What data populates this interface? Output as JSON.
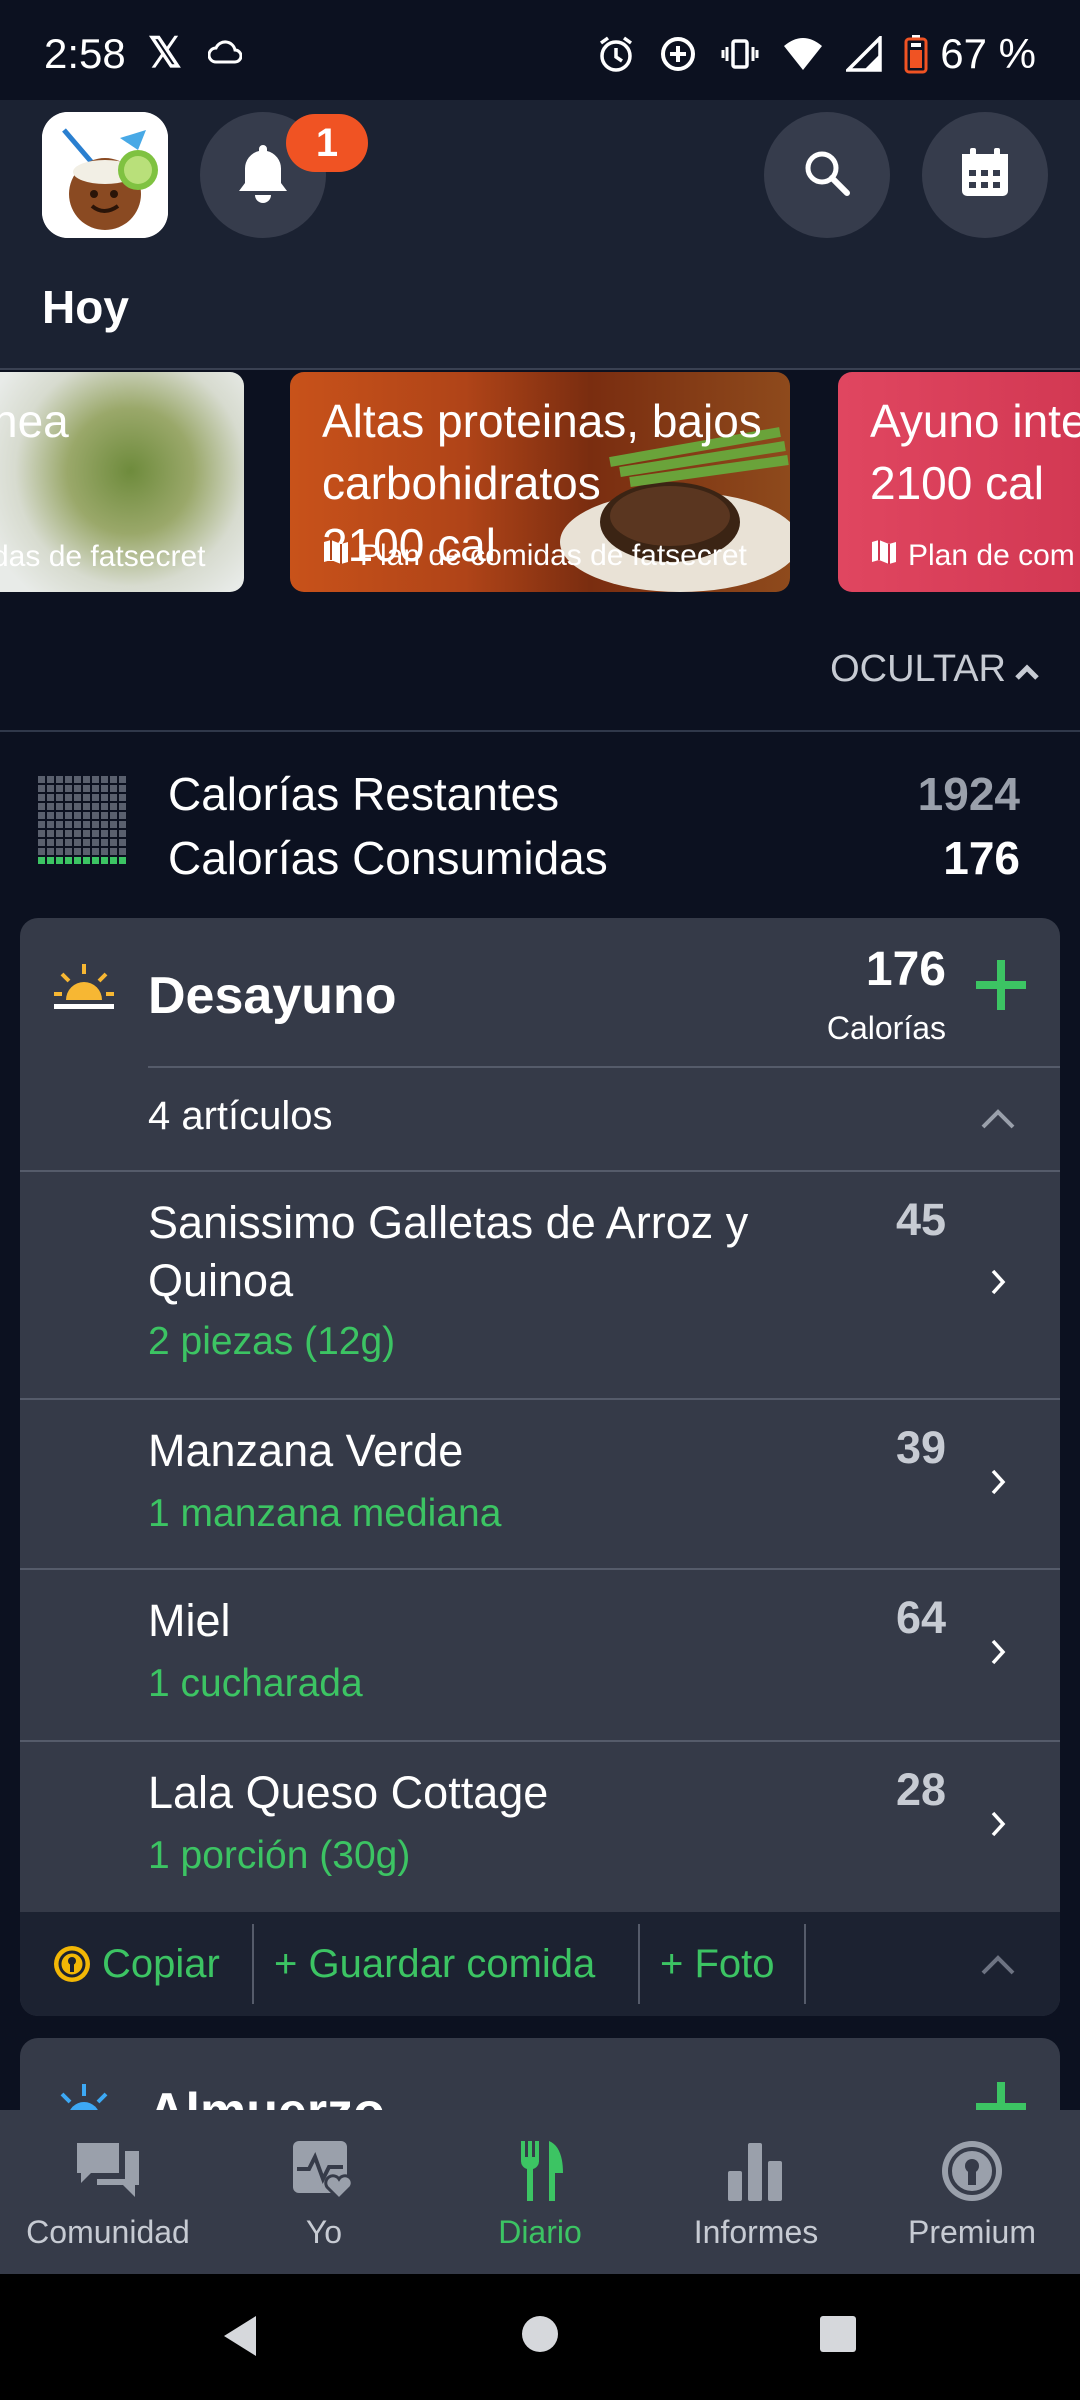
{
  "status_bar": {
    "time": "2:58",
    "x_app": "𝕏",
    "battery_text": "67 %"
  },
  "header": {
    "notification_count": "1",
    "title": "Hoy"
  },
  "carousel": [
    {
      "title": "nea",
      "subtitle": "das de fatsecret"
    },
    {
      "title": "Altas proteinas, bajos\ncarbohidratos\n2100 cal",
      "subtitle": "Plan de comidas de fatsecret"
    },
    {
      "title": "Ayuno inte\n2100 cal",
      "subtitle": "Plan de com"
    }
  ],
  "hide_link": "OCULTAR",
  "calories": {
    "remaining_label": "Calorías Restantes",
    "consumed_label": "Calorías Consumidas",
    "remaining_value": "1924",
    "consumed_value": "176"
  },
  "meal": {
    "name": "Desayuno",
    "calories": "176",
    "calories_label": "Calorías",
    "items_count": "4 artículos",
    "items": [
      {
        "name": "Sanissimo Galletas de Arroz y Quinoa",
        "portion": "2 piezas (12g)",
        "calories": "45"
      },
      {
        "name": "Manzana Verde",
        "portion": "1 manzana mediana",
        "calories": "39"
      },
      {
        "name": "Miel",
        "portion": "1 cucharada",
        "calories": "64"
      },
      {
        "name": "Lala Queso Cottage",
        "portion": "1 porción (30g)",
        "calories": "28"
      }
    ],
    "actions": {
      "copy": "Copiar",
      "save": "+ Guardar comida",
      "photo": "+ Foto"
    }
  },
  "next_meal": {
    "name": "Almuerzo"
  },
  "bottom_nav": [
    {
      "label": "Comunidad",
      "icon": "chat-bubbles-icon"
    },
    {
      "label": "Yo",
      "icon": "heart-pulse-icon"
    },
    {
      "label": "Diario",
      "icon": "fork-knife-icon"
    },
    {
      "label": "Informes",
      "icon": "bar-chart-icon"
    },
    {
      "label": "Premium",
      "icon": "premium-keyhole-icon"
    }
  ],
  "colors": {
    "accent_green": "#3cc463",
    "badge_orange": "#f05323",
    "background": "#0c1120",
    "card": "#353a48"
  }
}
